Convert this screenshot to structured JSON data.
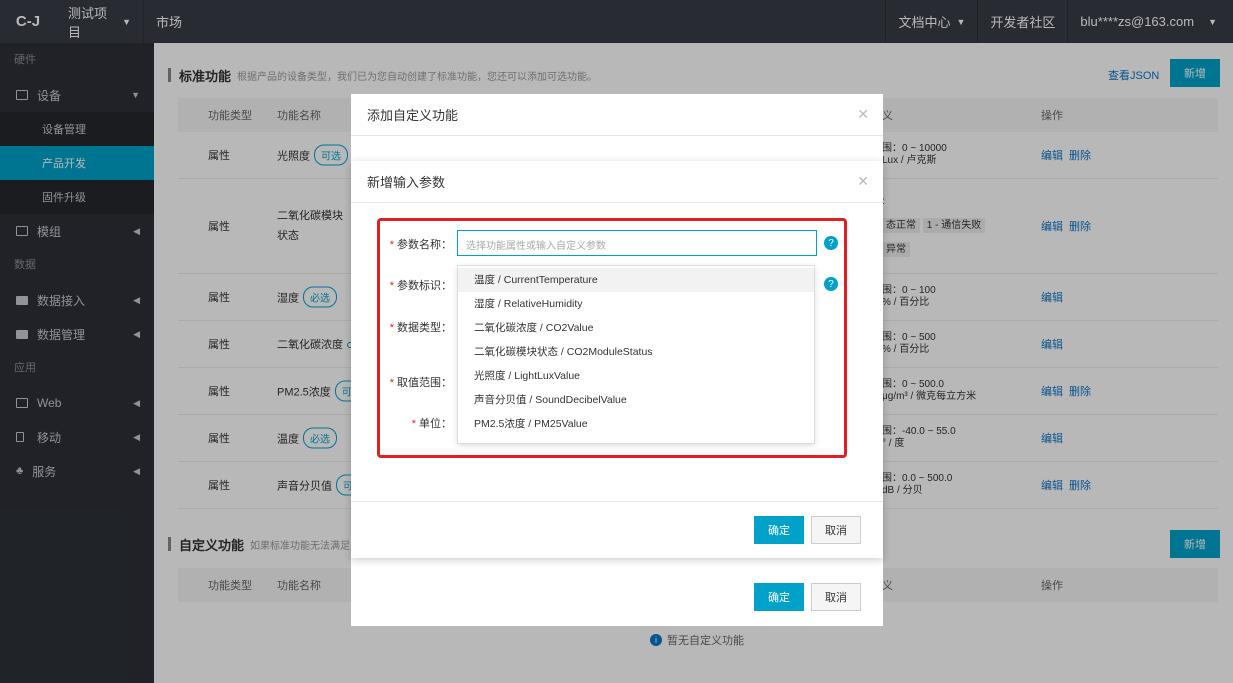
{
  "topbar": {
    "logo": "C-J",
    "project": "测试项目",
    "market": "市场",
    "docs": "文档中心",
    "community": "开发者社区",
    "user": "blu****zs@163.com"
  },
  "sidebar": {
    "group_hardware": "硬件",
    "device": "设备",
    "device_manage": "设备管理",
    "product_dev": "产品开发",
    "firmware": "固件升级",
    "module": "模组",
    "group_data": "数据",
    "data_access": "数据接入",
    "data_manage": "数据管理",
    "group_app": "应用",
    "web": "Web",
    "mobile": "移动",
    "service": "服务"
  },
  "standard": {
    "title": "标准功能",
    "desc": "根据产品的设备类型，我们已为您自动创建了标准功能，您还可以添加可选功能。",
    "view_json": "查看JSON",
    "new_btn": "新增",
    "headers": {
      "type": "功能类型",
      "name": "功能名称",
      "define": "义",
      "ops": "操作"
    },
    "rows": [
      {
        "type": "属性",
        "name": "光照度",
        "tag": "可选",
        "define1": "围：0 ~ 10000",
        "define2": "Lux / 卢克斯",
        "edit": "编辑",
        "del": "删除"
      },
      {
        "type": "属性",
        "name": "二氧化碳模块",
        "name2": "状态",
        "define1": ":",
        "chip1": "态正常",
        "chip2": "1 - 通信失败",
        "chip3": "异常",
        "edit": "编辑",
        "del": "删除"
      },
      {
        "type": "属性",
        "name": "湿度",
        "tag": "必选",
        "define1": "围：0 ~ 100",
        "define2": "% / 百分比",
        "edit": "编辑"
      },
      {
        "type": "属性",
        "name": "二氧化碳浓度",
        "tag": "",
        "define1": "围：0 ~ 500",
        "define2": "% / 百分比",
        "edit": "编辑"
      },
      {
        "type": "属性",
        "name": "PM2.5浓度",
        "tag": "可",
        "define1": "围：0 ~ 500.0",
        "define2": "μg/m³ / 微克每立方米",
        "edit": "编辑",
        "del": "删除"
      },
      {
        "type": "属性",
        "name": "温度",
        "tag": "必选",
        "define1": "围：-40.0 ~ 55.0",
        "define2": "° / 度",
        "edit": "编辑"
      },
      {
        "type": "属性",
        "name": "声音分贝值",
        "tag": "可",
        "define1": "围：0.0 ~ 500.0",
        "define2": "dB / 分贝",
        "edit": "编辑",
        "del": "删除"
      }
    ]
  },
  "custom": {
    "title": "自定义功能",
    "desc": "如果标准功能无法满足",
    "new_btn": "新增",
    "headers": {
      "type": "功能类型",
      "name": "功能名称",
      "define": "义",
      "ops": "操作"
    },
    "empty": "暂无自定义功能"
  },
  "modal_outer": {
    "title": "添加自定义功能",
    "ok": "确定",
    "cancel": "取消"
  },
  "modal_inner": {
    "title": "新增输入参数",
    "label_name": "参数名称：",
    "label_id": "参数标识：",
    "label_type": "数据类型：",
    "label_range": "取值范围：",
    "label_unit": "单位：",
    "name_placeholder": "选择功能属性或输入自定义参数",
    "ok": "确定",
    "cancel": "取消",
    "options": [
      "温度 / CurrentTemperature",
      "湿度 / RelativeHumidity",
      "二氧化碳浓度 / CO2Value",
      "二氧化碳模块状态 / CO2ModuleStatus",
      "光照度 / LightLuxValue",
      "声音分贝值 / SoundDecibelValue",
      "PM2.5浓度 / PM25Value"
    ]
  }
}
